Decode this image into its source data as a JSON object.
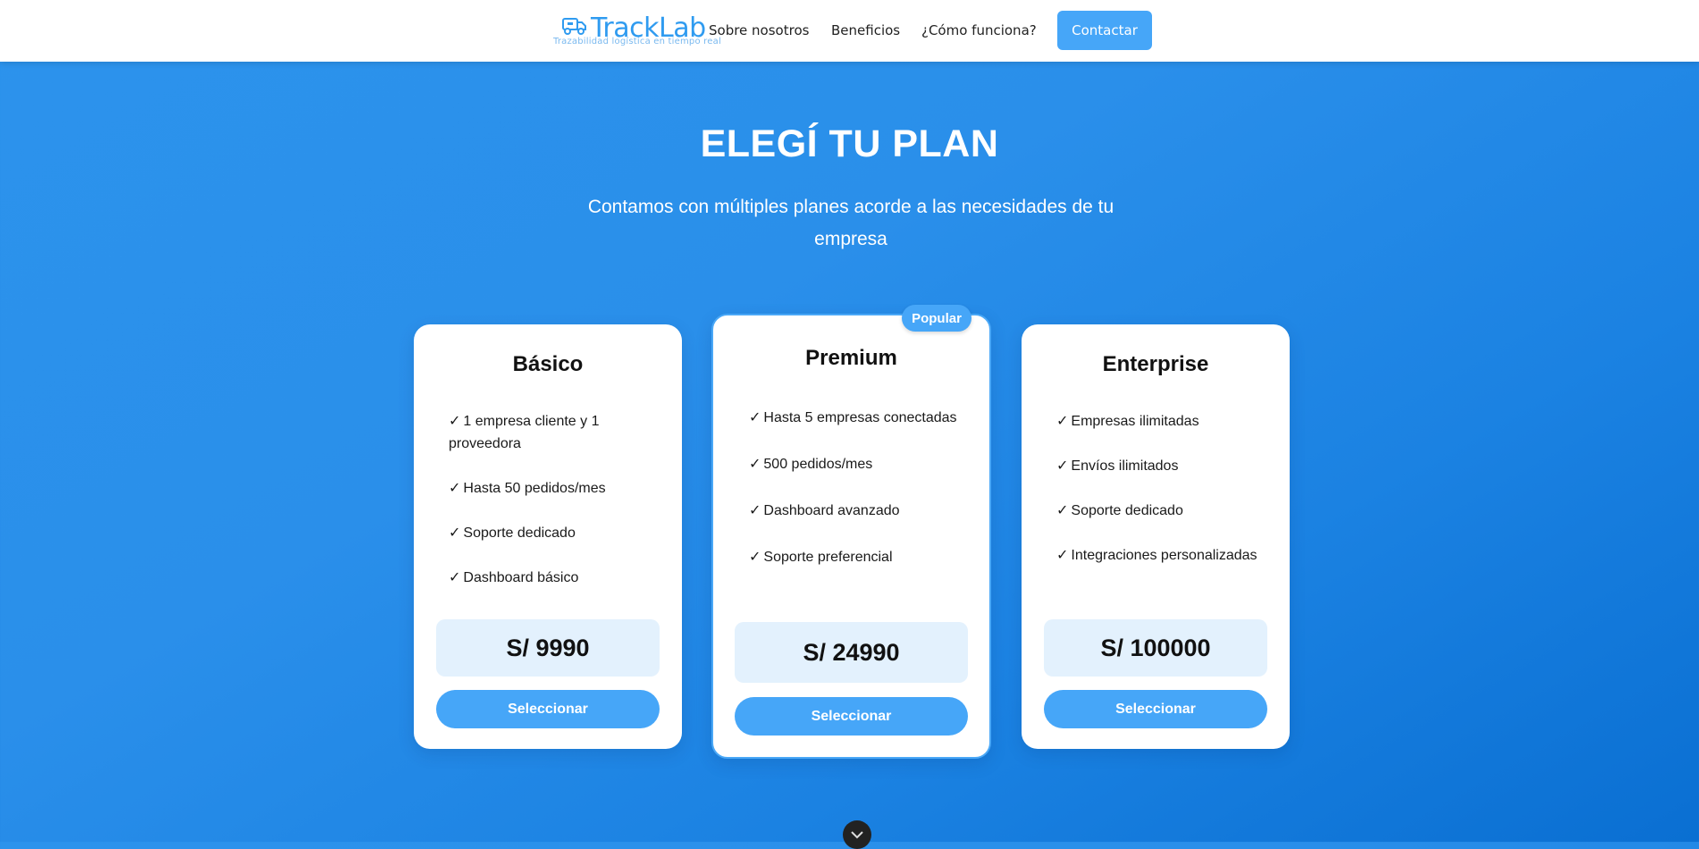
{
  "header": {
    "brand_name": "TrackLab",
    "brand_tagline": "Trazabilidad logística en tiempo real",
    "nav": [
      "Sobre nosotros",
      "Beneficios",
      "¿Cómo funciona?"
    ],
    "contact_label": "Contactar"
  },
  "hero": {
    "title": "ELEGÍ TU PLAN",
    "subtitle": "Contamos con múltiples planes acorde a las necesidades de tu empresa"
  },
  "plans": [
    {
      "name": "Básico",
      "features": [
        "1 empresa cliente y 1 proveedora",
        "Hasta 50 pedidos/mes",
        "Soporte dedicado",
        "Dashboard básico"
      ],
      "price": "S/ 9990",
      "button": "Seleccionar"
    },
    {
      "name": "Premium",
      "badge": "Popular",
      "features": [
        "Hasta 5 empresas conectadas",
        "500 pedidos/mes",
        "Dashboard avanzado",
        "Soporte preferencial"
      ],
      "price": "S/ 24990",
      "button": "Seleccionar"
    },
    {
      "name": "Enterprise",
      "features": [
        "Empresas ilimitadas",
        "Envíos ilimitados",
        "Soporte dedicado",
        "Integraciones personalizadas"
      ],
      "price": "S/ 100000",
      "button": "Seleccionar"
    }
  ],
  "check_glyph": "✓",
  "colors": {
    "accent": "#46a6f8",
    "price_bg": "#e3f1fd",
    "brand": "#2f9bf0"
  },
  "icons": {
    "brand": "truck-icon",
    "scroll": "chevron-down-icon"
  }
}
